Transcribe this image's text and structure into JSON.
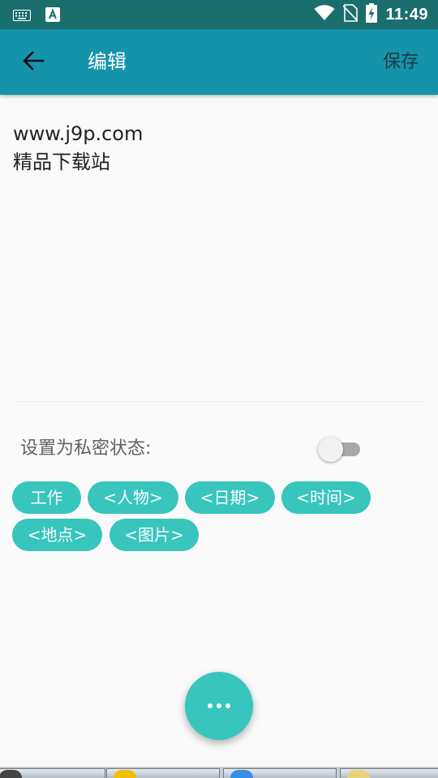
{
  "status_bar": {
    "time": "11:49",
    "icons": [
      "keyboard-icon",
      "app-notification-icon",
      "wifi-icon",
      "no-sim-icon",
      "battery-charging-icon"
    ]
  },
  "app_bar": {
    "back_icon": "arrow-left-icon",
    "title": "编辑",
    "save_label": "保存"
  },
  "note": {
    "lines": [
      "www.j9p.com",
      "精品下载站"
    ]
  },
  "privacy": {
    "label": "设置为私密状态:",
    "enabled": false
  },
  "tags": [
    "工作",
    "<人物>",
    "<日期>",
    "<时间>",
    "<地点>",
    "<图片>"
  ],
  "fab": {
    "icon": "more-horizontal-icon"
  },
  "colors": {
    "status_bar": "#1a6f6c",
    "app_bar": "#1493ab",
    "accent": "#37c5be",
    "background": "#fafafa"
  }
}
